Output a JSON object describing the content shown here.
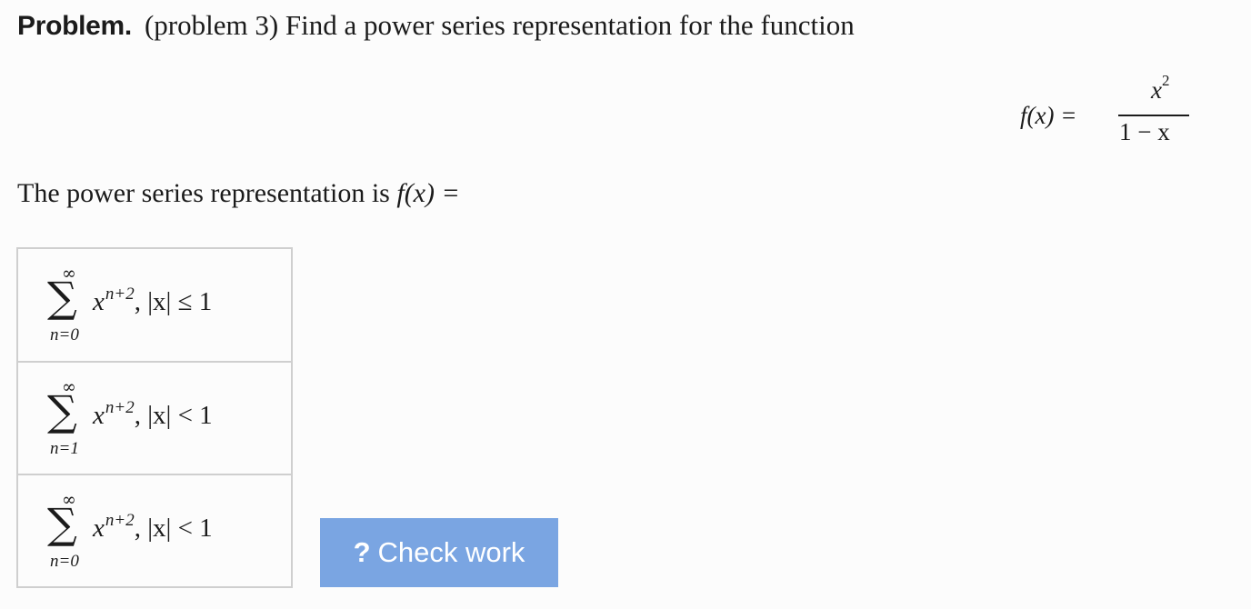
{
  "problem": {
    "label": "Problem.",
    "text": "(problem 3) Find a power series representation for the function"
  },
  "function_display": {
    "lhs": "f(x) =",
    "numerator_base": "x",
    "numerator_exp": "2",
    "denominator": "1 − x"
  },
  "prompt": {
    "text": "The power series representation is",
    "expr": "f(x) ="
  },
  "choices": [
    {
      "upper": "∞",
      "sigma": "∑",
      "lower": "n=0",
      "base": "x",
      "exp": "n+2",
      "condition": ", |x| ≤ 1"
    },
    {
      "upper": "∞",
      "sigma": "∑",
      "lower": "n=1",
      "base": "x",
      "exp": "n+2",
      "condition": ", |x| < 1"
    },
    {
      "upper": "∞",
      "sigma": "∑",
      "lower": "n=0",
      "base": "x",
      "exp": "n+2",
      "condition": ", |x| < 1"
    }
  ],
  "check_button": {
    "icon": "?",
    "label": "Check work",
    "color": "#7aa5e2"
  }
}
